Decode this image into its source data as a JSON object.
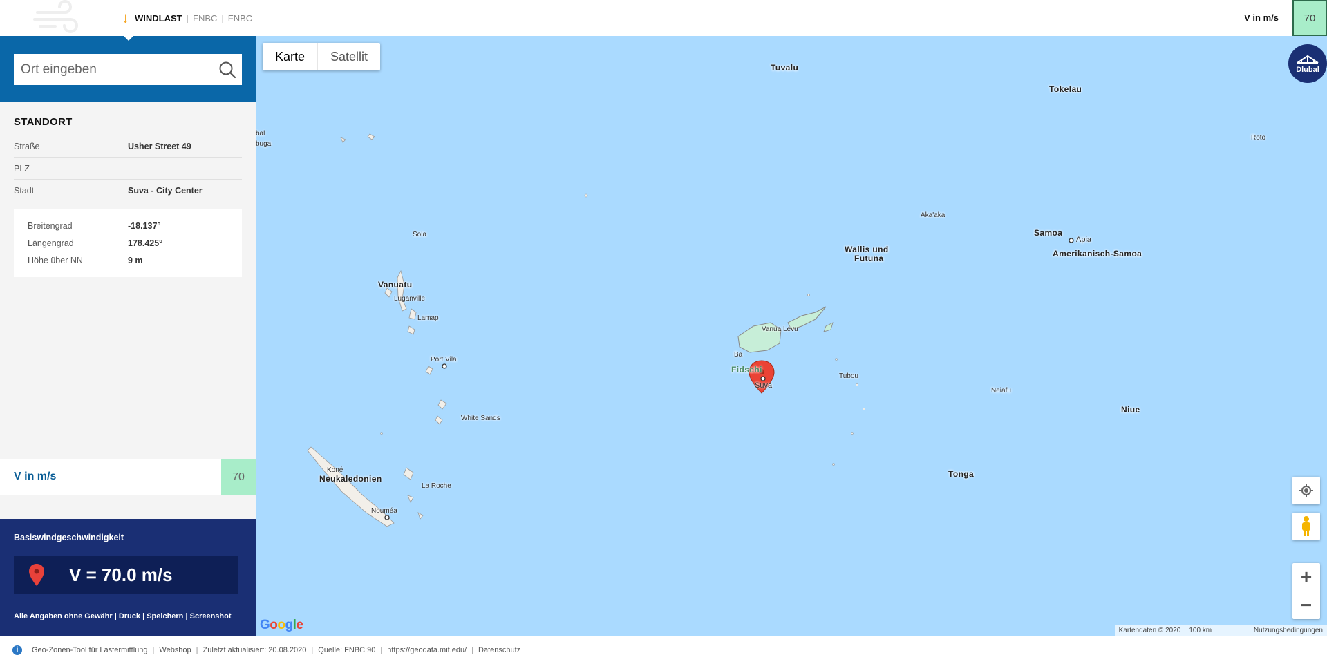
{
  "nav": {
    "active": "WINDLAST",
    "items": [
      "FNBC",
      "FNBC"
    ],
    "sep": "|"
  },
  "header": {
    "v_label": "V in m/s",
    "v_value": "70"
  },
  "search": {
    "placeholder": "Ort eingeben"
  },
  "location": {
    "title": "STANDORT",
    "address": [
      {
        "label": "Straße",
        "value": "Usher Street 49"
      },
      {
        "label": "PLZ",
        "value": ""
      },
      {
        "label": "Stadt",
        "value": "Suva - City Center"
      }
    ],
    "coords": [
      {
        "label": "Breitengrad",
        "value": "-18.137°"
      },
      {
        "label": "Längengrad",
        "value": "178.425°"
      },
      {
        "label": "Höhe über NN",
        "value": "9 m"
      }
    ]
  },
  "v_band": {
    "label": "V in m/s",
    "value": "70"
  },
  "result": {
    "title": "Basiswindgeschwindigkeit",
    "value": "V = 70.0 m/s",
    "links": [
      "Alle Angaben ohne Gewähr",
      "Druck",
      "Speichern",
      "Screenshot"
    ],
    "sep": "|"
  },
  "map": {
    "type_buttons": {
      "map": "Karte",
      "satellite": "Satellit"
    },
    "labels": {
      "tuvalu": "Tuvalu",
      "tokelau": "Tokelau",
      "roto": "Roto",
      "samoa": "Samoa",
      "apia": "Apia",
      "amsamoa": "Amerikanisch-Samoa",
      "akaaka": "Aka'aka",
      "wallis1": "Wallis und",
      "wallis2": "Futuna",
      "sola": "Sola",
      "vanuatu": "Vanuatu",
      "luganville": "Luganville",
      "lamap": "Lamap",
      "portvila": "Port Vila",
      "whitesands": "White Sands",
      "vanualevu": "Vanua Levu",
      "fidschi": "Fidschi",
      "suva": "Suva",
      "ba": "Ba",
      "tubou": "Tubou",
      "neiafu": "Neiafu",
      "niue": "Niue",
      "tonga": "Tonga",
      "neukaledonien": "Neukaledonien",
      "kone": "Koné",
      "laroche": "La Roche",
      "noumea": "Nouméa",
      "edge1": "bal",
      "edge2": "buga"
    },
    "brand": "Dlubal",
    "google": "Google",
    "attribution": {
      "data": "Kartendaten © 2020",
      "scale": "100 km",
      "terms": "Nutzungsbedingungen"
    }
  },
  "footer": {
    "items": [
      "Geo-Zonen-Tool für Lastermittlung",
      "Webshop",
      "Zuletzt aktualisiert: 20.08.2020",
      "Quelle: FNBC:90",
      "https://geodata.mit.edu/",
      "Datenschutz"
    ],
    "sep": "|"
  },
  "colors": {
    "primary": "#0a67a8",
    "dark_blue": "#1a2f74",
    "green": "#a8edc9",
    "accent": "#f5a623",
    "water": "#aadaff"
  }
}
